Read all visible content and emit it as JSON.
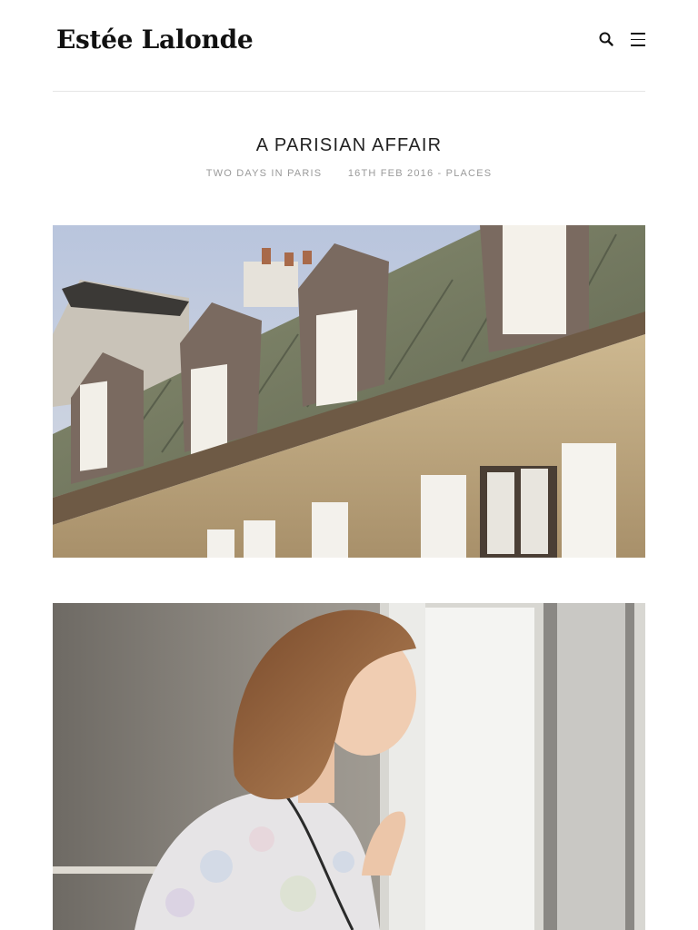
{
  "site": {
    "logo": "Estée Lalonde"
  },
  "header": {
    "search_icon": "search-icon",
    "menu_icon": "hamburger-menu-icon"
  },
  "post": {
    "title": "A PARISIAN AFFAIR",
    "subtitle": "TWO DAYS IN PARIS",
    "date_category": "16TH FEB 2016 - PLACES"
  },
  "colors": {
    "text": "#222222",
    "meta": "#9a9a9a",
    "divider": "#e6e6e6"
  }
}
